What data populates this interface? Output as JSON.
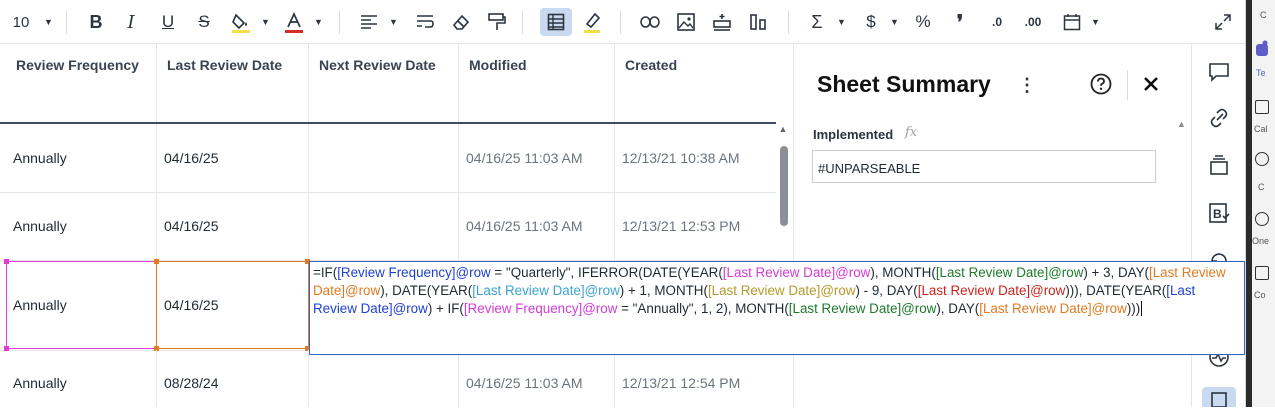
{
  "toolbar": {
    "font_size": "10"
  },
  "grid": {
    "columns": [
      "Review Frequency",
      "Last Review Date",
      "Next Review Date",
      "Modified",
      "Created"
    ],
    "rows": [
      {
        "frequency": "Annually",
        "last_review": "04/16/25",
        "next_review": "",
        "modified": "04/16/25 11:03 AM",
        "created": "12/13/21 10:38 AM"
      },
      {
        "frequency": "Annually",
        "last_review": "04/16/25",
        "next_review": "",
        "modified": "04/16/25 11:03 AM",
        "created": "12/13/21 12:53 PM"
      },
      {
        "frequency": "Annually",
        "last_review": "04/16/25",
        "next_review": "",
        "modified": "",
        "created": ""
      },
      {
        "frequency": "Annually",
        "last_review": "08/28/24",
        "next_review": "",
        "modified": "04/16/25 11:03 AM",
        "created": "12/13/21 12:54 PM"
      }
    ]
  },
  "formula": {
    "t1": "=IF(",
    "t2": "[Review Frequency]@row",
    "t3": " = \"Quarterly\", IFERROR(DATE(YEAR(",
    "t4": "[Last Review Date]@row",
    "t5": "), MONTH(",
    "t6": "[Last Review Date]@row",
    "t7": ") + 3, DAY(",
    "t8": "[Last Review Date]@row",
    "t9": "), DATE(YEAR(",
    "t10": "[Last Review Date]@row",
    "t11": ") + 1, MONTH(",
    "t12": "[Last Review Date]@row",
    "t13": ") - 9, DAY(",
    "t14": "[Last Review Date]@row",
    "t15": "))), DATE(YEAR(",
    "t16": "[Last Review Date]@row",
    "t17": ") + IF(",
    "t18": "[Review Frequency]@row",
    "t19": " = \"Annually\", 1, 2), MONTH(",
    "t20": "[Last Review Date]@row",
    "t21": "), DAY(",
    "t22": "[Last Review Date]@row",
    "t23": ")))"
  },
  "panel": {
    "title": "Sheet Summary",
    "field_label": "Implemented",
    "fx_symbol": "fx",
    "field_value": "#UNPARSEABLE"
  },
  "outer_strip": {
    "labels": [
      "C",
      "Te",
      "Cal",
      "C",
      "One",
      "Co"
    ]
  },
  "colors": {
    "accent_blue": "#2f66c8",
    "selection_pink": "#e23bd6",
    "selection_orange": "#e07b21",
    "active_tool_bg": "#c9daf0"
  }
}
